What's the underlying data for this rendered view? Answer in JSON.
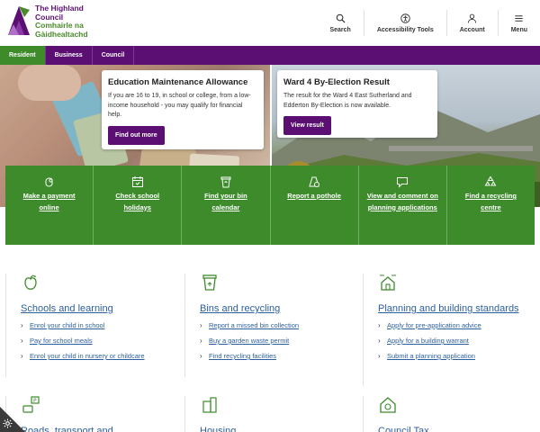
{
  "header": {
    "logo": {
      "line1": "The Highland",
      "line2": "Council",
      "line3": "Comhairle na",
      "line4": "Gàidhealtachd"
    },
    "tools": [
      {
        "label": "Search",
        "icon": "search-icon"
      },
      {
        "label": "Accessibility Tools",
        "icon": "accessibility-icon"
      },
      {
        "label": "Account",
        "icon": "user-icon"
      },
      {
        "label": "Menu",
        "icon": "menu-icon"
      }
    ]
  },
  "topnav": {
    "tabs": [
      "Resident",
      "Business",
      "Council"
    ],
    "active": "Resident"
  },
  "hero": {
    "left_card": {
      "title": "Education Maintenance Allowance",
      "text": "If you are 16 to 19, in school or college, from a low-income household - you may qualify for financial help.",
      "button": "Find out more"
    },
    "right_card": {
      "title": "Ward 4 By-Election Result",
      "text": "The result for the Ward 4 East Sutherland and Edderton By-Election is now available.",
      "button": "View result"
    }
  },
  "quick_links": [
    {
      "label": "Make a payment online",
      "icon": "payment-icon"
    },
    {
      "label": "Check school holidays",
      "icon": "calendar-icon"
    },
    {
      "label": "Find your bin calendar",
      "icon": "bin-icon"
    },
    {
      "label": "Report a pothole",
      "icon": "pothole-icon"
    },
    {
      "label": "View and comment on planning applications",
      "icon": "comment-icon"
    },
    {
      "label": "Find a recycling centre",
      "icon": "recycling-icon"
    }
  ],
  "services": [
    {
      "title": "Schools and learning",
      "icon": "apple-icon",
      "links": [
        "Enrol your child in school",
        "Pay for school meals",
        "Enrol your child in nursery or childcare"
      ]
    },
    {
      "title": "Bins and recycling",
      "icon": "bin-icon",
      "links": [
        "Report a missed bin collection",
        "Buy a garden waste permit",
        "Find recycling facilities"
      ]
    },
    {
      "title": "Planning and building standards",
      "icon": "house-plan-icon",
      "links": [
        "Apply for pre-application advice",
        "Apply for a building warrant",
        "Submit a planning application"
      ]
    },
    {
      "title": "Roads, transport and",
      "icon": "roads-icon",
      "links": []
    },
    {
      "title": "Housing",
      "icon": "housing-icon",
      "links": []
    },
    {
      "title": "Council Tax",
      "icon": "council-tax-icon",
      "links": []
    }
  ],
  "colors": {
    "purple": "#5b0f72",
    "green": "#3e8b2c",
    "link": "#2c5f9e"
  }
}
